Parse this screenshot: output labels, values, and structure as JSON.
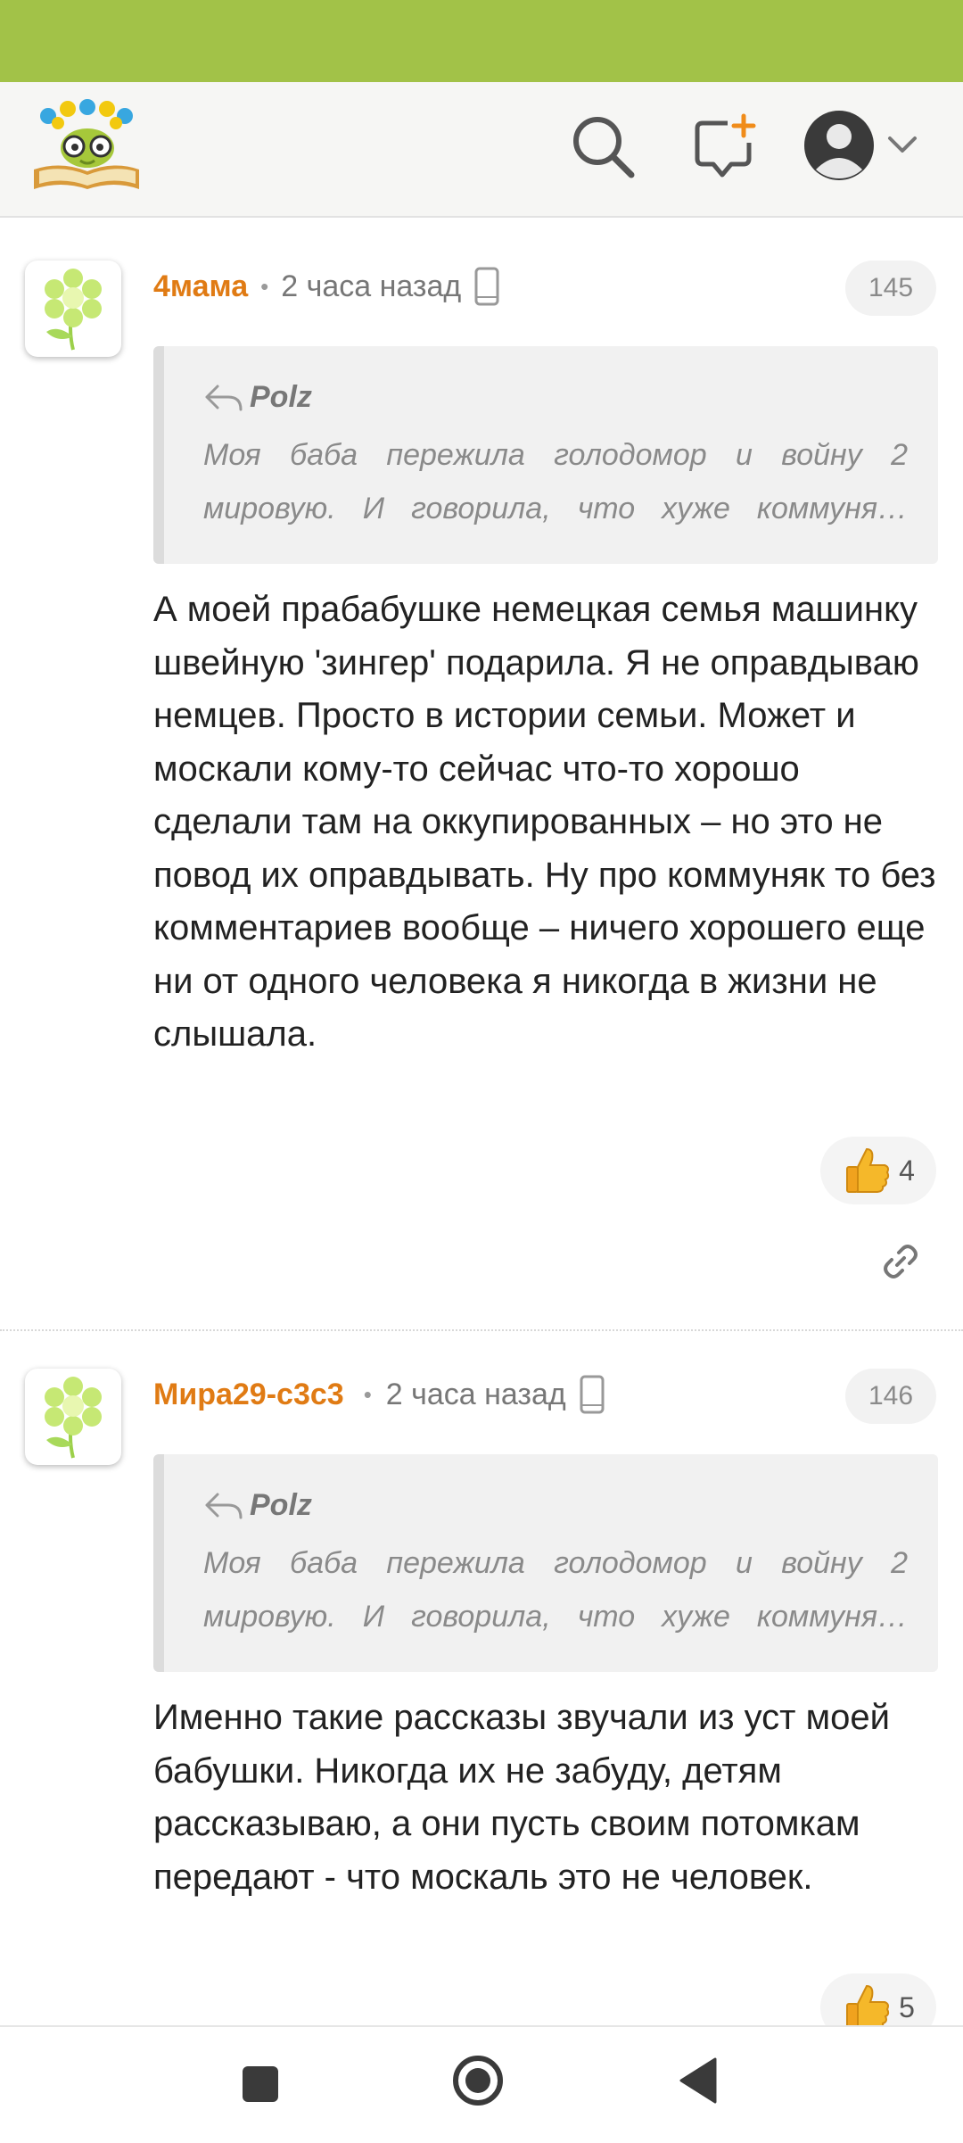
{
  "header": {
    "icons": [
      "logo",
      "search-icon",
      "new-message-icon",
      "account-icon",
      "chevron-down-icon"
    ]
  },
  "comments": [
    {
      "author": "4мама",
      "time": "2 часа назад",
      "number": "145",
      "quote_author": "Polz",
      "quote_text": "Моя баба пережила голодомор и войну 2 мировую. И говорила, что хуже коммуня…",
      "text": "А моей прабабушке немецкая семья машинку швейную 'зингер' подарила. Я не оправдываю немцев. Просто в истории семьи. Может и москали кому-то сейчас что-то хорошо сделали там на оккупированных – но это не повод их оправдывать. Ну про коммуняк то без комментариев вообще – ничего хорошего еще ни от одного человека я никогда в жизни не слышала.",
      "likes": "4"
    },
    {
      "author": "Мира29-с3с3",
      "time": "2 часа назад",
      "number": "146",
      "quote_author": "Polz",
      "quote_text": "Моя баба пережила голодомор и войну 2 мировую. И говорила, что хуже коммуня…",
      "text": "Именно такие рассказы звучали из уст моей бабушки. Никогда их не забуду, детям рассказываю, а они пусть своим потомкам передают - что москаль это не человек.",
      "likes": "5"
    }
  ],
  "colors": {
    "status_bar": "#a2c248",
    "author": "#e07b14",
    "accent_orange": "#f08c1a"
  },
  "navbar": {
    "icons": [
      "recents-square-icon",
      "home-circle-icon",
      "back-triangle-icon"
    ]
  }
}
